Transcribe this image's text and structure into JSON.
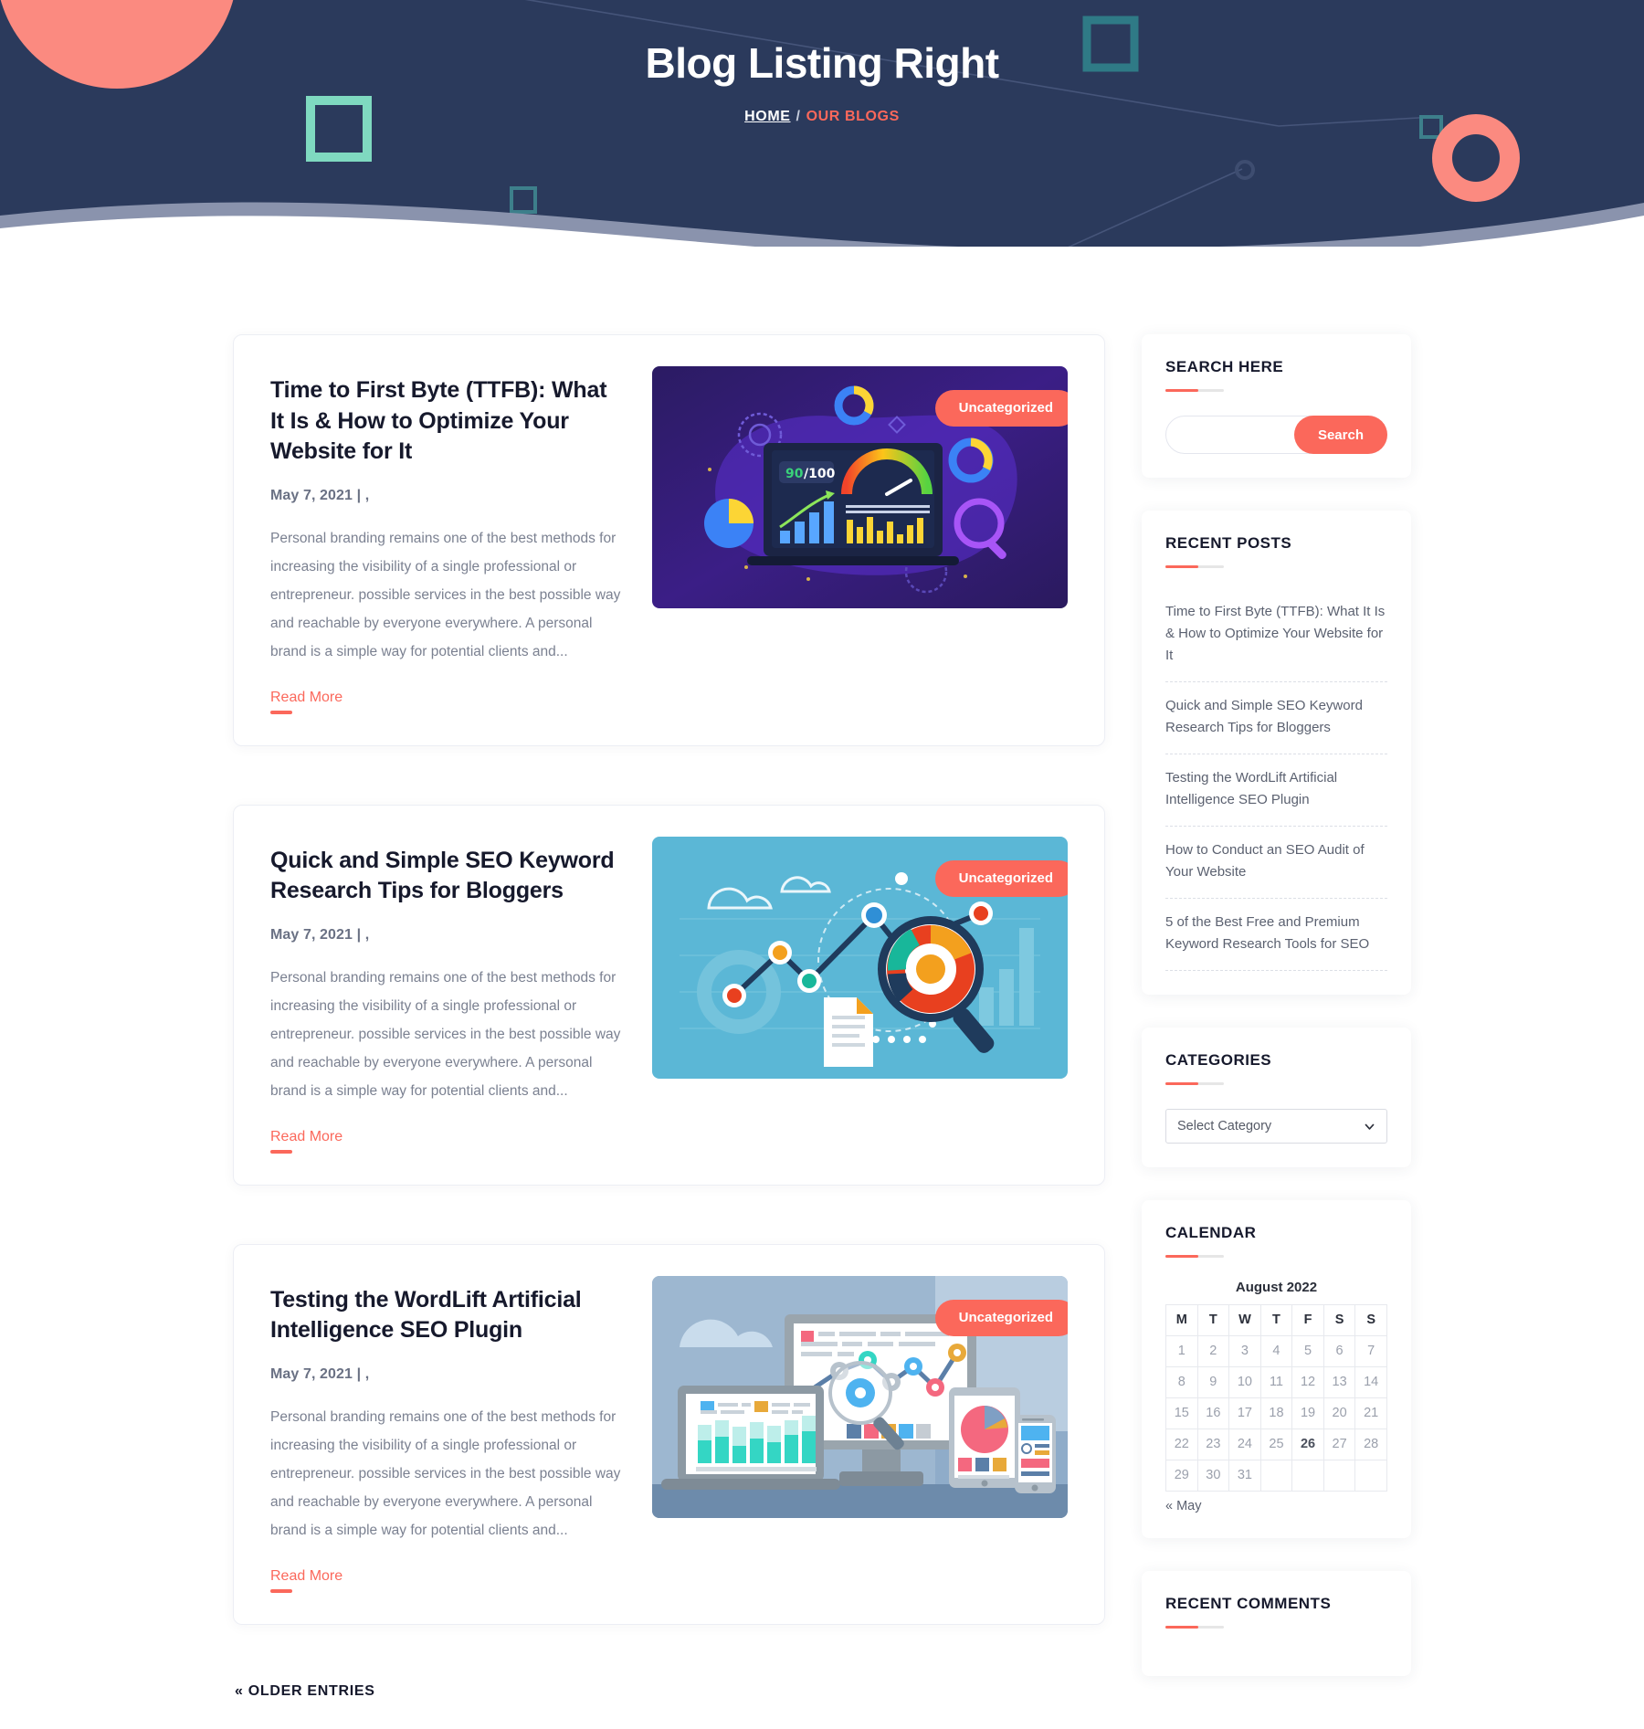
{
  "banner": {
    "title": "Blog Listing Right",
    "breadcrumb": {
      "home": "HOME",
      "separator": "/",
      "current": "OUR BLOGS"
    },
    "bg_color": "#2b3a5c",
    "accent_color": "#fb685b",
    "mint_color": "#7fd9c0",
    "teal_color": "#2f7a86"
  },
  "posts": [
    {
      "title": "Time to First Byte (TTFB): What It Is & How to Optimize Your Website for It",
      "date": "May 7, 2021 | ,",
      "excerpt": "Personal branding remains one of the best methods for increasing the visibility of a single professional or entrepreneur. possible services in the best possible way and reachable by everyone everywhere. A personal brand is a simple way for potential clients and...",
      "read_more": "Read More",
      "category_badge": "Uncategorized",
      "thumb": "ttfb-speed-gauge-illustration",
      "thumb_score": "90",
      "thumb_score_total": "/100"
    },
    {
      "title": "Quick and Simple SEO Keyword Research Tips for Bloggers",
      "date": "May 7, 2021 | ,",
      "excerpt": "Personal branding remains one of the best methods for increasing the visibility of a single professional or entrepreneur. possible services in the best possible way and reachable by everyone everywhere. A personal brand is a simple way for potential clients and...",
      "read_more": "Read More",
      "category_badge": "Uncategorized",
      "thumb": "keyword-research-chart-illustration"
    },
    {
      "title": "Testing the WordLift Artificial Intelligence SEO Plugin",
      "date": "May 7, 2021 | ,",
      "excerpt": "Personal branding remains one of the best methods for increasing the visibility of a single professional or entrepreneur. possible services in the best possible way and reachable by everyone everywhere. A personal brand is a simple way for potential clients and...",
      "read_more": "Read More",
      "category_badge": "Uncategorized",
      "thumb": "multi-device-analytics-illustration"
    }
  ],
  "pagination": {
    "older_entries": "« OLDER ENTRIES"
  },
  "sidebar": {
    "search": {
      "title": "SEARCH HERE",
      "input_value": "",
      "placeholder": "",
      "button_label": "Search"
    },
    "recent_posts": {
      "title": "RECENT POSTS",
      "items": [
        "Time to First Byte (TTFB): What It Is & How to Optimize Your Website for It",
        "Quick and Simple SEO Keyword Research Tips for Bloggers",
        "Testing the WordLift Artificial Intelligence SEO Plugin",
        "How to Conduct an SEO Audit of Your Website",
        "5 of the Best Free and Premium Keyword Research Tools for SEO"
      ]
    },
    "categories": {
      "title": "CATEGORIES",
      "selected": "Select Category",
      "options": [
        "Select Category"
      ]
    },
    "calendar": {
      "title": "CALENDAR",
      "caption": "August 2022",
      "weekdays": [
        "M",
        "T",
        "W",
        "T",
        "F",
        "S",
        "S"
      ],
      "weeks": [
        [
          "1",
          "2",
          "3",
          "4",
          "5",
          "6",
          "7"
        ],
        [
          "8",
          "9",
          "10",
          "11",
          "12",
          "13",
          "14"
        ],
        [
          "15",
          "16",
          "17",
          "18",
          "19",
          "20",
          "21"
        ],
        [
          "22",
          "23",
          "24",
          "25",
          "26",
          "27",
          "28"
        ],
        [
          "29",
          "30",
          "31",
          "",
          "",
          "",
          ""
        ]
      ],
      "today": "26",
      "prev_link": "« May"
    },
    "recent_comments": {
      "title": "RECENT COMMENTS",
      "items": []
    }
  }
}
